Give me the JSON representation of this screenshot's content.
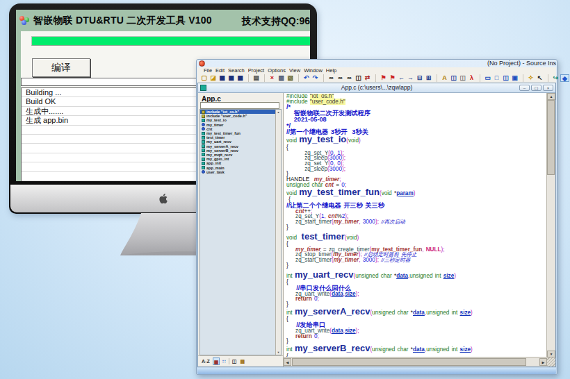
{
  "builder_app": {
    "title": "智嵌物联 DTU&RTU 二次开发工具 V100",
    "support": "技术支持QQ:96",
    "progress_color": "#00ec6c",
    "compile_button": "编译",
    "log_lines": [
      "Building ...",
      "Build OK",
      "生成中.......",
      "生成 app.bin"
    ]
  },
  "source_insight": {
    "window_title": "(No Project) - Source Ins",
    "menu": [
      "File",
      "Edit",
      "Search",
      "Project",
      "Options",
      "View",
      "Window",
      "Help"
    ],
    "toolbar": [
      {
        "name": "new-file",
        "g": "▢",
        "c": "#b8860b"
      },
      {
        "name": "open-file",
        "g": "◪",
        "c": "#c8960c"
      },
      {
        "name": "save",
        "g": "▦",
        "c": "#1a2f7a"
      },
      {
        "name": "save-all",
        "g": "▦",
        "c": "#1a2f7a"
      },
      {
        "name": "save-copy",
        "g": "▦",
        "c": "#1a2f7a"
      },
      {
        "sep": true
      },
      {
        "name": "print",
        "g": "▤",
        "c": "#555555"
      },
      {
        "sep": true
      },
      {
        "name": "cut",
        "g": "×",
        "c": "#cc1111"
      },
      {
        "name": "copy",
        "g": "▥",
        "c": "#334466"
      },
      {
        "name": "paste",
        "g": "▧",
        "c": "#666633"
      },
      {
        "sep": true
      },
      {
        "name": "undo",
        "g": "↶",
        "c": "#2255cc"
      },
      {
        "name": "redo",
        "g": "↷",
        "c": "#2255cc"
      },
      {
        "sep": true
      },
      {
        "name": "find",
        "g": "∞",
        "c": "#111111"
      },
      {
        "name": "find-next",
        "g": "∞",
        "c": "#111111"
      },
      {
        "name": "find-previous",
        "g": "∞",
        "c": "#111111"
      },
      {
        "name": "find-in-files",
        "g": "◫",
        "c": "#111111"
      },
      {
        "name": "replace",
        "g": "⇄",
        "c": "#aa2222"
      },
      {
        "sep": true
      },
      {
        "name": "bookmark",
        "g": "⚑",
        "c": "#cc2222"
      },
      {
        "name": "bookmark-list",
        "g": "⚑",
        "c": "#cc2222"
      },
      {
        "name": "go-back",
        "g": "←",
        "c": "#223c8c"
      },
      {
        "name": "go-forward",
        "g": "→",
        "c": "#223c8c"
      },
      {
        "name": "jump-out",
        "g": "⊟",
        "c": "#223c8c"
      },
      {
        "name": "jump-in",
        "g": "⊞",
        "c": "#223c8c"
      },
      {
        "sep": true
      },
      {
        "name": "browse-symbol",
        "g": "A",
        "c": "#b07700"
      },
      {
        "name": "browse-project-symbols",
        "g": "◫",
        "c": "#1a3fa0"
      },
      {
        "name": "browse-files",
        "g": "◫",
        "c": "#777777"
      },
      {
        "name": "run",
        "g": "λ",
        "c": "#cc1111"
      },
      {
        "sep": true
      },
      {
        "name": "window-tile",
        "g": "▭",
        "c": "#2050c0"
      },
      {
        "name": "window-full",
        "g": "□",
        "c": "#2050c0"
      },
      {
        "name": "window-split",
        "g": "◫",
        "c": "#2050c0"
      },
      {
        "name": "window-cascade",
        "g": "▣",
        "c": "#2050c0"
      },
      {
        "sep": true
      },
      {
        "name": "key-command",
        "g": "✧",
        "c": "#c89000"
      },
      {
        "name": "select-tool",
        "g": "↖",
        "c": "#222222"
      },
      {
        "sep": true
      },
      {
        "name": "link-window",
        "g": "↪",
        "c": "#118877"
      },
      {
        "name": "symbol-window-toggle",
        "g": "◆",
        "c": "#2255cc",
        "pressed": true
      },
      {
        "name": "relation-window",
        "g": "‹",
        "c": "#119988"
      },
      {
        "name": "context-window",
        "g": "∴",
        "c": "#cc7788"
      },
      {
        "name": "clip-window",
        "g": "▣",
        "c": "#bb3333"
      }
    ],
    "child": {
      "title": "App.c (c:\\users\\...\\zqwlapp)",
      "buttons": [
        "–",
        "▢",
        "×"
      ],
      "panel_label": "App.c",
      "search_value": "",
      "symbols": [
        {
          "icon": "include",
          "label": "include \"iot_os.h\"",
          "selected": true
        },
        {
          "icon": "include",
          "label": "include \"user_code.h\""
        },
        {
          "icon": "fn",
          "label": "my_test_io"
        },
        {
          "icon": "var",
          "label": "my_timer"
        },
        {
          "icon": "var",
          "label": "cnt"
        },
        {
          "icon": "fn",
          "label": "my_test_timer_fun"
        },
        {
          "icon": "fn",
          "label": "test_timer"
        },
        {
          "icon": "fn",
          "label": "my_uart_recv"
        },
        {
          "icon": "fn",
          "label": "my_serverA_recv"
        },
        {
          "icon": "fn",
          "label": "my_serverB_recv"
        },
        {
          "icon": "fn",
          "label": "my_mqtt_recv"
        },
        {
          "icon": "fn",
          "label": "my_gpio_int"
        },
        {
          "icon": "fn",
          "label": "app_init"
        },
        {
          "icon": "fn",
          "label": "app_main"
        },
        {
          "icon": "var",
          "label": "user_task"
        }
      ],
      "footer": [
        {
          "name": "sort-alpha",
          "g": "A-Z",
          "c": "#333333"
        },
        {
          "name": "group-by-type",
          "g": "▦",
          "c": "#993333",
          "pressed": true
        },
        {
          "name": "symbol-colors",
          "g": "∷",
          "c": "#2255cc"
        },
        {
          "sep": true
        },
        {
          "name": "browse-mode",
          "g": "◫",
          "c": "#333333"
        },
        {
          "name": "properties",
          "g": "▤",
          "c": "#996600"
        }
      ]
    },
    "code": [
      {
        "s": "n",
        "seg": [
          [
            "pp",
            "#include "
          ],
          [
            "str",
            "\"iot_os.h\""
          ]
        ]
      },
      {
        "s": "n",
        "seg": [
          [
            "pp",
            "#include "
          ],
          [
            "str",
            "\"user_code.h\""
          ]
        ]
      },
      {
        "s": "c",
        "seg": [
          [
            "cmt",
            "/*"
          ]
        ]
      },
      {
        "s": "c",
        "seg": [
          [
            "cmt",
            "   智嵌物联二次开发测试程序"
          ]
        ]
      },
      {
        "s": "c",
        "seg": [
          [
            "cmt",
            "   2021-05-08"
          ]
        ]
      },
      {
        "s": "c",
        "seg": [
          [
            "cmt",
            "*/"
          ]
        ]
      },
      {
        "s": "c",
        "seg": [
          [
            "cmt",
            "//第一个继电器 3秒开  3秒关"
          ]
        ]
      },
      {
        "s": "f",
        "seg": [
          [
            "kw",
            "void "
          ],
          [
            "fn",
            "my_test_io"
          ],
          [
            "pun",
            "("
          ],
          [
            "kw",
            "void"
          ],
          [
            "pun",
            ")"
          ]
        ]
      },
      {
        "s": "n",
        "seg": [
          [
            "pl",
            "{"
          ]
        ]
      },
      {
        "s": "n",
        "seg": [
          [
            "pl",
            "        "
          ],
          [
            "call",
            "zq_set_Y"
          ],
          [
            "pun",
            "("
          ],
          [
            "num",
            "0"
          ],
          [
            "pun",
            ", "
          ],
          [
            "num",
            "1"
          ],
          [
            "pun",
            ");"
          ]
        ]
      },
      {
        "s": "n",
        "seg": [
          [
            "pl",
            "        "
          ],
          [
            "call",
            "zq_sleep"
          ],
          [
            "pun",
            "("
          ],
          [
            "num",
            "3000"
          ],
          [
            "pun",
            ");"
          ]
        ]
      },
      {
        "s": "n",
        "seg": [
          [
            "pl",
            "        "
          ],
          [
            "call",
            "zq_set_Y"
          ],
          [
            "pun",
            "("
          ],
          [
            "num",
            "0"
          ],
          [
            "pun",
            ", "
          ],
          [
            "num",
            "0"
          ],
          [
            "pun",
            ");"
          ]
        ]
      },
      {
        "s": "n",
        "seg": [
          [
            "pl",
            "        "
          ],
          [
            "call",
            "zq_sleep"
          ],
          [
            "pun",
            "("
          ],
          [
            "num",
            "3000"
          ],
          [
            "pun",
            ");"
          ]
        ]
      },
      {
        "s": "n",
        "seg": [
          [
            "pl",
            "}"
          ]
        ]
      },
      {
        "s": "n",
        "seg": [
          [
            "pl",
            "HANDLE  "
          ],
          [
            "var",
            "my_timer"
          ],
          [
            "pun",
            ";"
          ]
        ]
      },
      {
        "s": "n",
        "seg": [
          [
            "kw",
            "unsigned char "
          ],
          [
            "var",
            "cnt"
          ],
          [
            "pl",
            " = "
          ],
          [
            "num",
            "0"
          ],
          [
            "pun",
            ";"
          ]
        ]
      },
      {
        "s": "f",
        "seg": [
          [
            "kw",
            "void "
          ],
          [
            "fn",
            "my_test_timer_fun"
          ],
          [
            "pun",
            "("
          ],
          [
            "kw",
            "void "
          ],
          [
            "pl",
            "*"
          ],
          [
            "par",
            "param"
          ],
          [
            "pun",
            ")"
          ]
        ]
      },
      {
        "s": "n",
        "seg": [
          [
            "pl",
            " {"
          ]
        ]
      },
      {
        "s": "c",
        "seg": [
          [
            "cmt",
            "//让第二个个继电器 开三秒 关三秒"
          ]
        ]
      },
      {
        "s": "n",
        "seg": [
          [
            "pl",
            "    "
          ],
          [
            "var",
            "cnt"
          ],
          [
            "pl",
            "++"
          ],
          [
            "pun",
            ";"
          ]
        ]
      },
      {
        "s": "n",
        "seg": [
          [
            "pl",
            "    "
          ],
          [
            "call",
            "zq_set_Y"
          ],
          [
            "pun",
            "("
          ],
          [
            "num",
            "1"
          ],
          [
            "pun",
            ", "
          ],
          [
            "var",
            "cnt"
          ],
          [
            "pl",
            "%"
          ],
          [
            "num",
            "2"
          ],
          [
            "pun",
            ");"
          ]
        ]
      },
      {
        "s": "n",
        "seg": [
          [
            "pl",
            "    "
          ],
          [
            "call",
            "zq_start_timer"
          ],
          [
            "pun",
            "("
          ],
          [
            "var",
            "my_timer"
          ],
          [
            "pun",
            ", "
          ],
          [
            "num",
            "3000"
          ],
          [
            "pun",
            "); "
          ],
          [
            "cmti",
            "//再次启动"
          ]
        ]
      },
      {
        "s": "n",
        "seg": [
          [
            "pl",
            "}"
          ]
        ]
      },
      {
        "s": "b",
        "seg": []
      },
      {
        "s": "f",
        "seg": [
          [
            "kw",
            "void  "
          ],
          [
            "fn",
            "test_timer"
          ],
          [
            "pun",
            "("
          ],
          [
            "kw",
            "void"
          ],
          [
            "pun",
            ")"
          ]
        ]
      },
      {
        "s": "n",
        "seg": [
          [
            "pl",
            "{"
          ]
        ]
      },
      {
        "s": "n",
        "seg": [
          [
            "pl",
            "    "
          ],
          [
            "var",
            "my_timer"
          ],
          [
            "pl",
            " = "
          ],
          [
            "call",
            "zq_create_timer"
          ],
          [
            "pun",
            "("
          ],
          [
            "fnr",
            "my_test_timer_fun"
          ],
          [
            "pun",
            ", "
          ],
          [
            "cnst",
            "NULL"
          ],
          [
            "pun",
            ");"
          ]
        ]
      },
      {
        "s": "n",
        "seg": [
          [
            "pl",
            "    "
          ],
          [
            "call",
            "zq_stop_timer"
          ],
          [
            "pun",
            "("
          ],
          [
            "var",
            "my_timer"
          ],
          [
            "pun",
            "); "
          ],
          [
            "cmti",
            "//启动定时器前 先停止"
          ]
        ]
      },
      {
        "s": "n",
        "seg": [
          [
            "pl",
            "    "
          ],
          [
            "call",
            "zq_start_timer"
          ],
          [
            "pun",
            "("
          ],
          [
            "var",
            "my_timer"
          ],
          [
            "pun",
            ", "
          ],
          [
            "num",
            "3000"
          ],
          [
            "pun",
            "); "
          ],
          [
            "cmti",
            "//三秒定时器"
          ]
        ]
      },
      {
        "s": "n",
        "seg": [
          [
            "pl",
            "}"
          ]
        ]
      },
      {
        "s": "b",
        "seg": []
      },
      {
        "s": "f",
        "seg": [
          [
            "kw",
            "int "
          ],
          [
            "fn",
            "my_uart_recv"
          ],
          [
            "pun",
            "("
          ],
          [
            "kw",
            "unsigned char "
          ],
          [
            "pl",
            "*"
          ],
          [
            "par",
            "data"
          ],
          [
            "pun",
            ","
          ],
          [
            "kw",
            "unsigned int "
          ],
          [
            "par",
            "size"
          ],
          [
            "pun",
            ")"
          ]
        ]
      },
      {
        "s": "n",
        "seg": [
          [
            "pl",
            "{"
          ]
        ]
      },
      {
        "s": "c",
        "seg": [
          [
            "pl",
            "    "
          ],
          [
            "cmt",
            "//串口发什么回什么"
          ]
        ]
      },
      {
        "s": "n",
        "seg": [
          [
            "pl",
            "    "
          ],
          [
            "call",
            "zq_uart_write"
          ],
          [
            "pun",
            "("
          ],
          [
            "par",
            "data"
          ],
          [
            "pun",
            ","
          ],
          [
            "par",
            "size"
          ],
          [
            "pun",
            ");"
          ]
        ]
      },
      {
        "s": "n",
        "seg": [
          [
            "pl",
            "    "
          ],
          [
            "ret",
            "return "
          ],
          [
            "num",
            "0"
          ],
          [
            "pun",
            ";"
          ]
        ]
      },
      {
        "s": "n",
        "seg": [
          [
            "pl",
            "}"
          ]
        ]
      },
      {
        "s": "f",
        "seg": [
          [
            "kw",
            "int "
          ],
          [
            "fn",
            "my_serverA_recv"
          ],
          [
            "pun",
            "("
          ],
          [
            "kw",
            "unsigned char "
          ],
          [
            "pl",
            "*"
          ],
          [
            "par",
            "data"
          ],
          [
            "pun",
            ","
          ],
          [
            "kw",
            "unsigned int "
          ],
          [
            "par",
            "size"
          ],
          [
            "pun",
            ")"
          ]
        ]
      },
      {
        "s": "n",
        "seg": [
          [
            "pl",
            "{"
          ]
        ]
      },
      {
        "s": "c",
        "seg": [
          [
            "pl",
            "    "
          ],
          [
            "cmt",
            "//发给串口"
          ]
        ]
      },
      {
        "s": "n",
        "seg": [
          [
            "pl",
            "    "
          ],
          [
            "call",
            "zq_uart_write"
          ],
          [
            "pun",
            "("
          ],
          [
            "par",
            "data"
          ],
          [
            "pun",
            ","
          ],
          [
            "par",
            "size"
          ],
          [
            "pun",
            ");"
          ]
        ]
      },
      {
        "s": "n",
        "seg": [
          [
            "pl",
            "    "
          ],
          [
            "ret",
            "return "
          ],
          [
            "num",
            "0"
          ],
          [
            "pun",
            ";"
          ]
        ]
      },
      {
        "s": "n",
        "seg": [
          [
            "pl",
            "}"
          ]
        ]
      },
      {
        "s": "f",
        "seg": [
          [
            "kw",
            "int "
          ],
          [
            "fn",
            "my_serverB_recv"
          ],
          [
            "pun",
            "("
          ],
          [
            "kw",
            "unsigned char "
          ],
          [
            "pl",
            "*"
          ],
          [
            "par",
            "data"
          ],
          [
            "pun",
            ","
          ],
          [
            "kw",
            "unsigned int "
          ],
          [
            "par",
            "size"
          ],
          [
            "pun",
            ")"
          ]
        ]
      },
      {
        "s": "n",
        "seg": [
          [
            "pl",
            "{"
          ]
        ]
      }
    ]
  }
}
